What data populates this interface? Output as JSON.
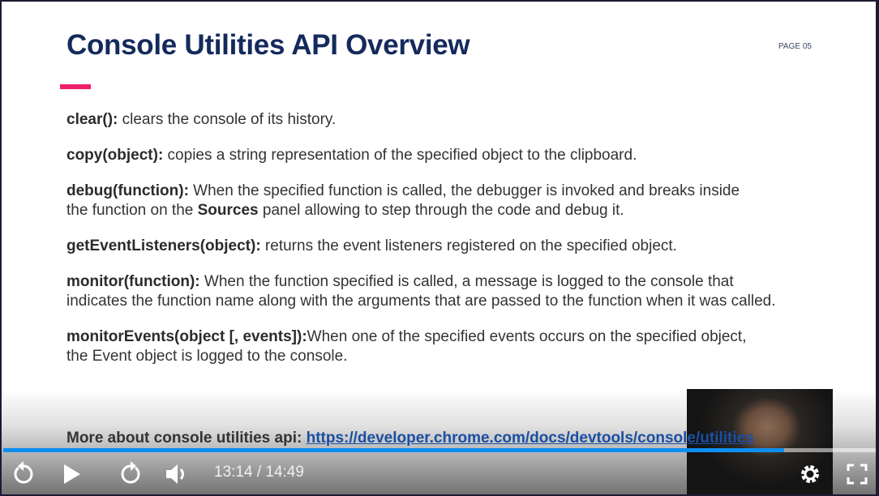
{
  "slide": {
    "title": "Console Utilities API Overview",
    "page_label": "PAGE 05",
    "accent_color": "#ee1f6b",
    "items": [
      {
        "term": "clear():",
        "desc": " clears the console of its history."
      },
      {
        "term": "copy(object):",
        "desc": " copies a string representation of the specified object to the clipboard."
      },
      {
        "term": "debug(function):",
        "desc": " When the specified function is called, the debugger is invoked and breaks inside the function on the ",
        "bold": "Sources",
        "desc2": " panel allowing to step through the code and debug it."
      },
      {
        "term": "getEventListeners(object):",
        "desc": " returns the event listeners registered on the specified object."
      },
      {
        "term": "monitor(function):",
        "desc": " When the function specified is called, a message is logged to the console that indicates the function name along with the arguments that are passed to the function when it was called."
      },
      {
        "term": "monitorEvents(object [, events]):",
        "desc": "When one of the specified events occurs on the specified object, the Event object is logged to the console."
      }
    ],
    "more_label": "More about console utilities api: ",
    "more_link": "https://developer.chrome.com/docs/devtools/console/utilities"
  },
  "player": {
    "current_time": "13:14",
    "separator": " / ",
    "duration": "14:49",
    "progress": 0.893,
    "progress_color": "#0c8ff0",
    "icons": [
      "replay-icon",
      "play-icon",
      "forward-icon",
      "volume-icon",
      "settings-icon",
      "fullscreen-icon"
    ]
  }
}
